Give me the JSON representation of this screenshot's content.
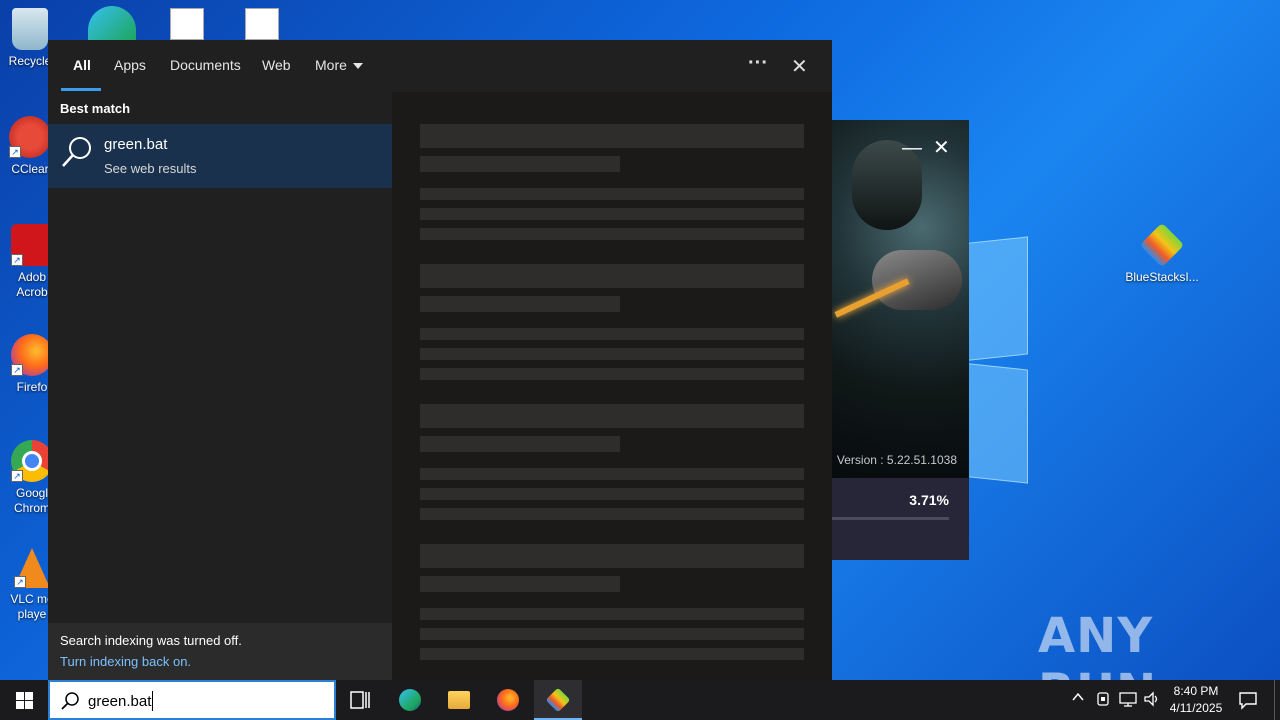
{
  "desktop": {
    "icons": [
      {
        "label": "Recycle",
        "sub": ""
      },
      {
        "label": "CClear",
        "sub": ""
      },
      {
        "label": "Adob",
        "sub": "Acrob"
      },
      {
        "label": "Firefo",
        "sub": ""
      },
      {
        "label": "Googl",
        "sub": "Chrom"
      },
      {
        "label": "VLC me",
        "sub": "playe"
      },
      {
        "label": "BlueStacksI...",
        "sub": ""
      }
    ]
  },
  "bluestacks": {
    "version": "Version : 5.22.51.1038",
    "percent": "3.71%",
    "progress": 0.0371,
    "minimize": "—",
    "close": "✕"
  },
  "search": {
    "tabs": [
      "All",
      "Apps",
      "Documents",
      "Web",
      "More"
    ],
    "more_label": "More",
    "menu_dots": "···",
    "close": "✕",
    "best_match_heading": "Best match",
    "result": {
      "title": "green.bat",
      "subtitle": "See web results"
    },
    "indexing_message": "Search indexing was turned off.",
    "indexing_link": "Turn indexing back on.",
    "query": "green.bat"
  },
  "watermark": "ANY RUN",
  "clock": {
    "time": "8:40 PM",
    "date": "4/11/2025"
  },
  "colors": {
    "accent": "#3b9cf0",
    "selection": "#19314c",
    "panel": "#202020"
  }
}
